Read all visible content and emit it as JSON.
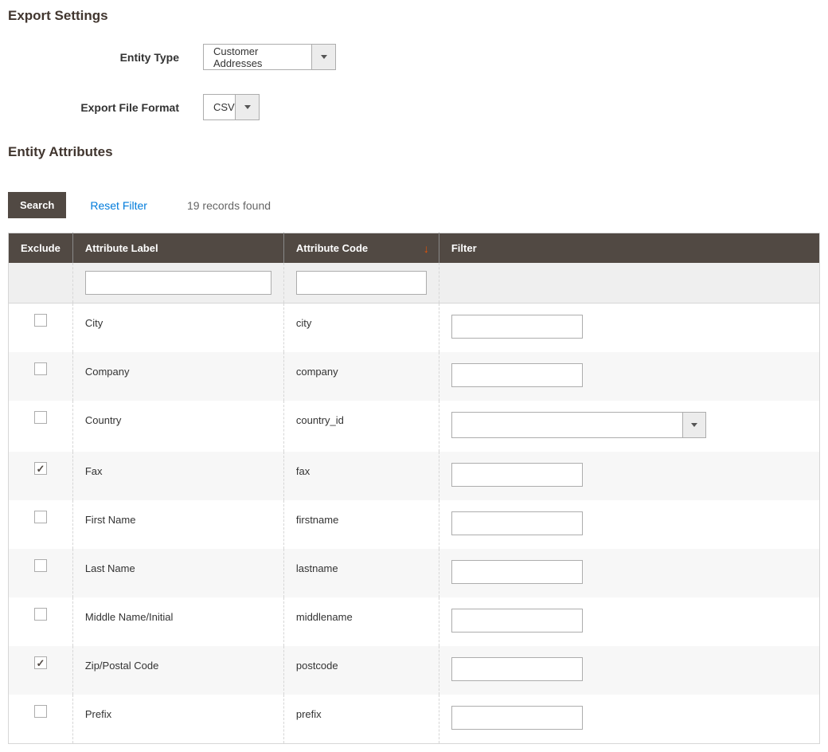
{
  "sections": {
    "export_settings_title": "Export Settings",
    "entity_attributes_title": "Entity Attributes"
  },
  "settings": {
    "entity_type_label": "Entity Type",
    "entity_type_value": "Customer Addresses",
    "file_format_label": "Export File Format",
    "file_format_value": "CSV"
  },
  "toolbar": {
    "search_label": "Search",
    "reset_filter_label": "Reset Filter",
    "records_found": "19 records found"
  },
  "columns": {
    "exclude": "Exclude",
    "attribute_label": "Attribute Label",
    "attribute_code": "Attribute Code",
    "filter": "Filter"
  },
  "rows": [
    {
      "excluded": false,
      "label": "City",
      "code": "city",
      "filter_type": "text"
    },
    {
      "excluded": false,
      "label": "Company",
      "code": "company",
      "filter_type": "text"
    },
    {
      "excluded": false,
      "label": "Country",
      "code": "country_id",
      "filter_type": "select"
    },
    {
      "excluded": true,
      "label": "Fax",
      "code": "fax",
      "filter_type": "text"
    },
    {
      "excluded": false,
      "label": "First Name",
      "code": "firstname",
      "filter_type": "text"
    },
    {
      "excluded": false,
      "label": "Last Name",
      "code": "lastname",
      "filter_type": "text"
    },
    {
      "excluded": false,
      "label": "Middle Name/Initial",
      "code": "middlename",
      "filter_type": "text"
    },
    {
      "excluded": true,
      "label": "Zip/Postal Code",
      "code": "postcode",
      "filter_type": "text"
    },
    {
      "excluded": false,
      "label": "Prefix",
      "code": "prefix",
      "filter_type": "text"
    }
  ]
}
